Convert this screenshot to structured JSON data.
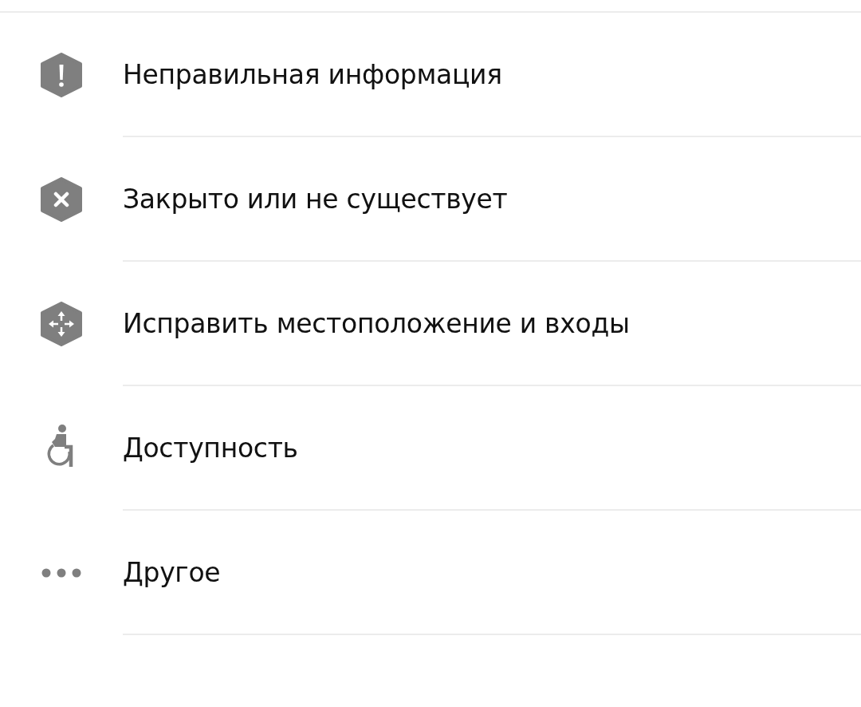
{
  "items": [
    {
      "kind": "warning",
      "label": "Неправильная информация"
    },
    {
      "kind": "closed",
      "label": "Закрыто или не существует"
    },
    {
      "kind": "move",
      "label": "Исправить местоположение и входы"
    },
    {
      "kind": "accessibility",
      "label": "Доступность"
    },
    {
      "kind": "other",
      "label": "Другое"
    }
  ]
}
